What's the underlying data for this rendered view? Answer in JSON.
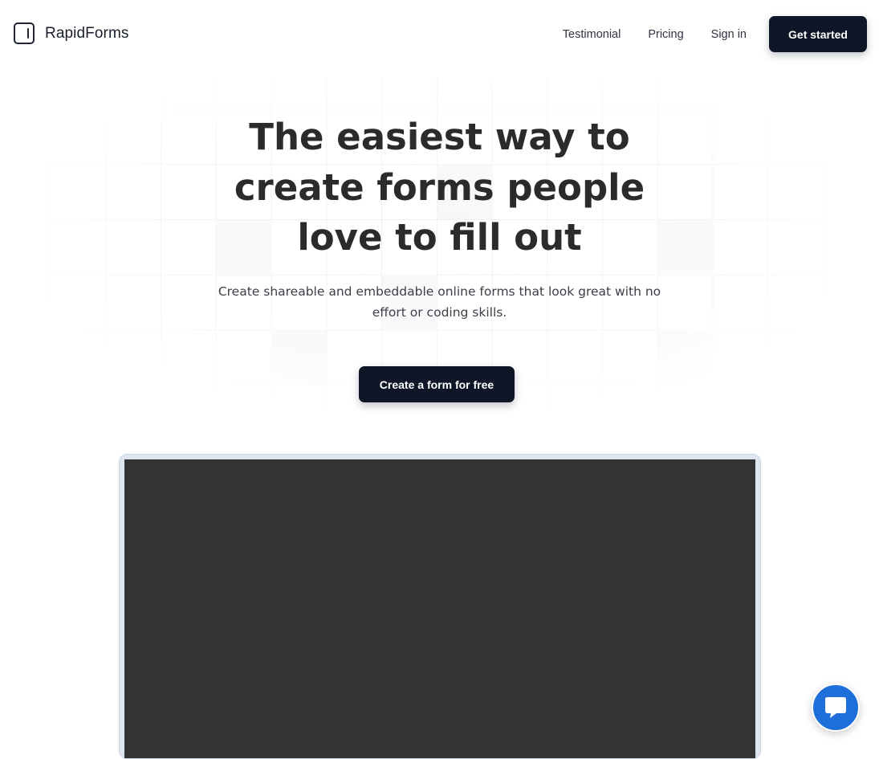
{
  "brand": {
    "name": "RapidForms",
    "icon": "form-panel-icon"
  },
  "nav": {
    "links": [
      "Testimonial",
      "Pricing",
      "Sign in"
    ],
    "cta": "Get started"
  },
  "hero": {
    "title_lines": [
      "The easiest way to",
      "create forms people",
      "love to fill out"
    ],
    "subtitle_line1": "Create shareable and embeddable online forms that look great with no",
    "subtitle_line2": "effort or coding skills.",
    "cta": "Create a form for free"
  },
  "chat": {
    "icon": "chat-bubble-icon"
  },
  "colors": {
    "primary": "#0f1627",
    "accent": "#1e6fd9",
    "preview": "#333333"
  }
}
